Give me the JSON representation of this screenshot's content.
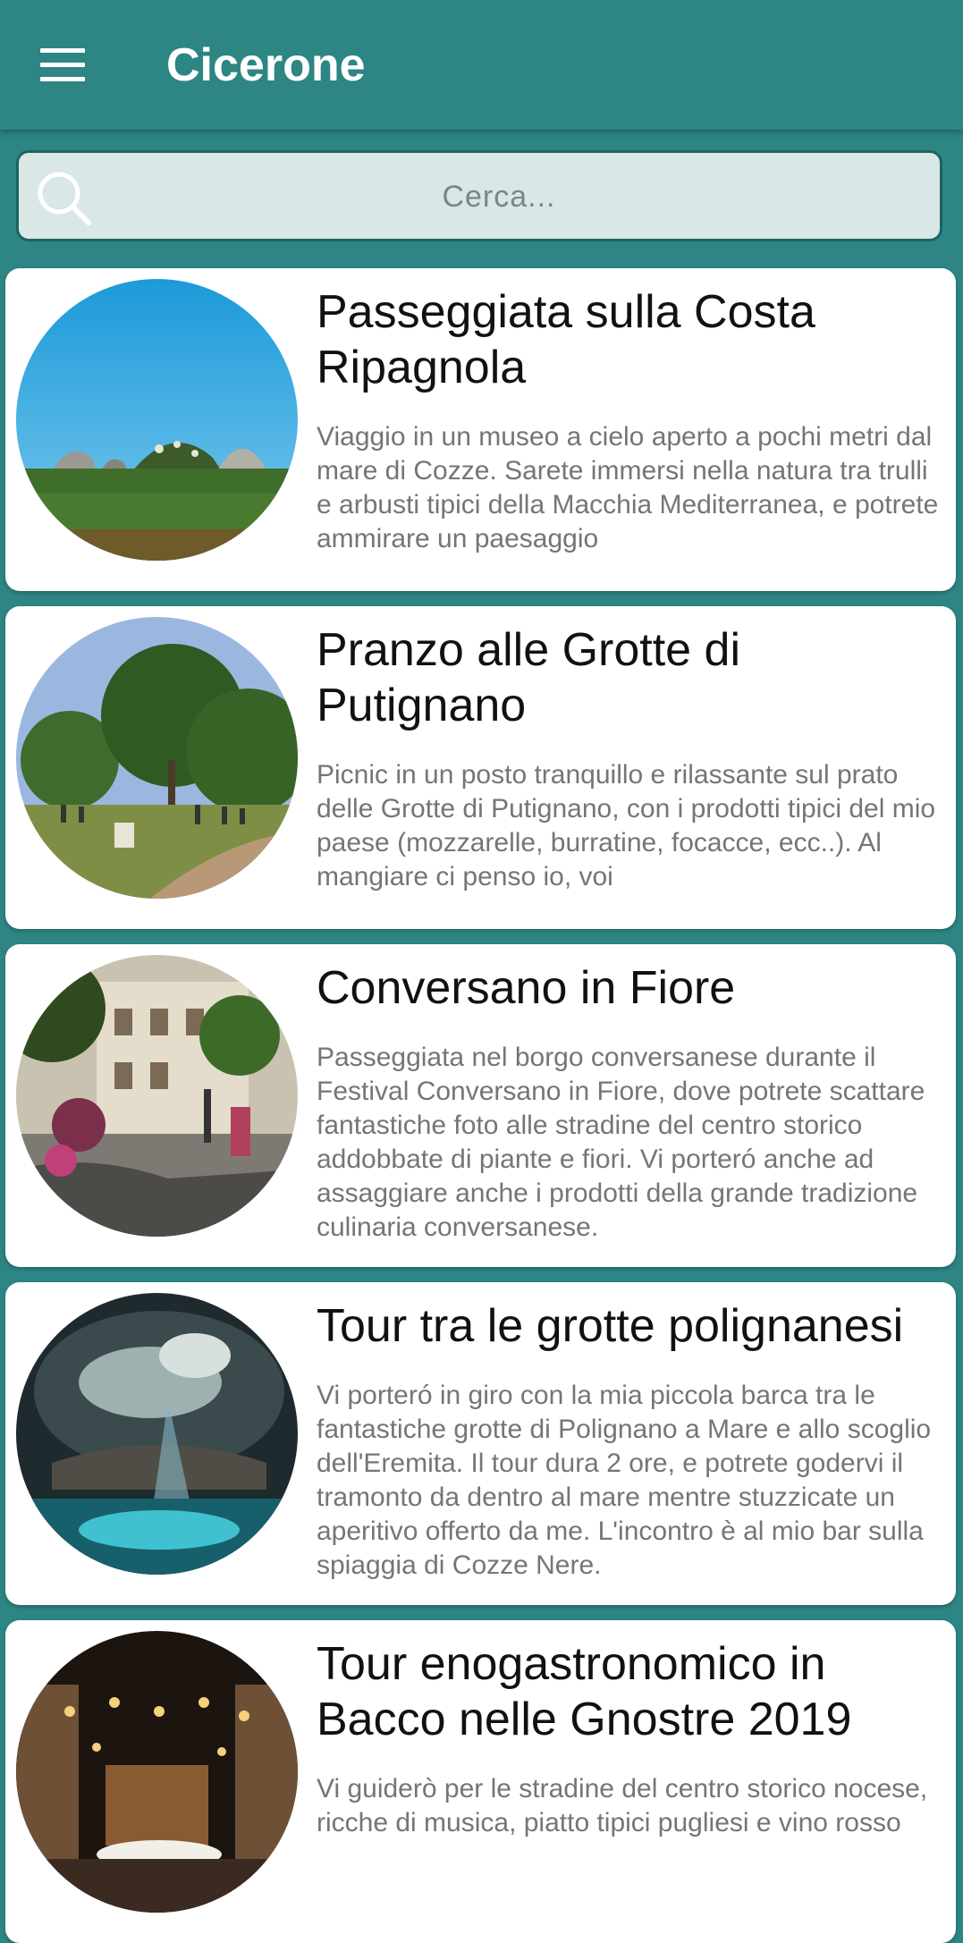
{
  "appbar": {
    "title": "Cicerone",
    "menu_icon": "hamburger-menu-icon"
  },
  "search": {
    "placeholder": "Cerca...",
    "icon": "search-icon"
  },
  "colors": {
    "primary": "#2d8584",
    "search_bg": "#d9e7e6",
    "search_border": "#1b6462",
    "card_bg": "#ffffff",
    "title_text": "#111111",
    "desc_text": "#757575"
  },
  "items": [
    {
      "title": "Passeggiata sulla Costa Ripagnola",
      "description": "Viaggio in un museo a cielo aperto a pochi metri dal mare di Cozze. Sarete immersi nella natura tra trulli e arbusti tipici della Macchia Mediterranea, e potrete ammirare un paesaggio"
    },
    {
      "title": "Pranzo alle Grotte di Putignano",
      "description": "Picnic in un posto tranquillo e rilassante sul prato delle Grotte di Putignano, con i prodotti tipici del mio paese (mozzarelle, burratine, focacce, ecc..). Al mangiare ci penso io, voi"
    },
    {
      "title": "Conversano in Fiore",
      "description": "Passeggiata nel borgo conversanese durante il Festival Conversano in Fiore, dove potrete scattare fantastiche foto alle stradine del centro storico addobbate di piante e fiori. Vi porteró anche ad assaggiare anche i prodotti della grande tradizione culinaria conversanese."
    },
    {
      "title": "Tour tra le grotte polignanesi",
      "description": "Vi porteró in giro con la mia piccola barca tra le fantastiche grotte di Polignano a Mare e allo scoglio dell'Eremita. Il tour dura 2 ore, e potrete godervi il tramonto da dentro al mare mentre stuzzicate un aperitivo offerto da me. L'incontro è al mio bar sulla spiaggia di Cozze Nere."
    },
    {
      "title": "Tour enogastronomico in Bacco nelle Gnostre 2019",
      "description": "Vi guiderò per le stradine del centro storico nocese, ricche di musica, piatto tipici pugliesi e vino rosso"
    }
  ]
}
